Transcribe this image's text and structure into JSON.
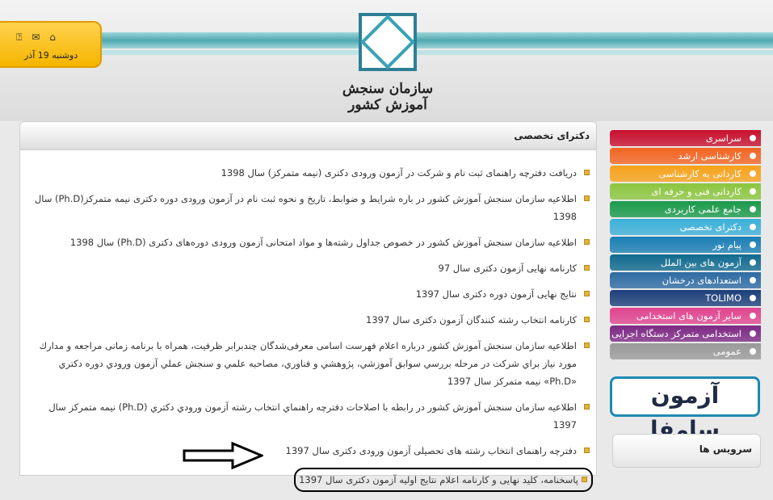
{
  "header": {
    "org_name": "سازمان سنجش آموزش کشور",
    "date": "دوشنبه 19 آذر",
    "icons": [
      "help-icon",
      "mail-icon",
      "home-icon"
    ]
  },
  "main": {
    "section_title": "دکترای تخصصی",
    "news": [
      "دریافت دفترچه راهنمای ثبت نام و شرکت در آزمون ورودی دکتری (نیمه متمرکز) سال 1398",
      "اطلاعیه سازمان سنجش آموزش کشور در باره شرایط و ضوابط، تاریخ و نحوه ثبت نام در آزمون ورودی دوره دکتری نیمه متمرکز(Ph.D) سال 1398",
      "اطلاعیه سازمان سنجش آموزش کشور در خصوص جداول رشته‌ها و مواد امتحانی آزمون ورودی دوره‌های دکتری (Ph.D) سال 1398",
      "کارنامه نهایی آزمون دکتری سال 97",
      "نتایج نهایی آزمون دوره دکتری سال 1397",
      "کارنامه انتخاب رشته کنندگان آزمون دکتری سال 1397",
      "اطلاعیه سازمان سنجش آموزش کشور درباره اعلام فهرست اسامی معرفی‌شدگان چندبرابر ظرفیت، همراه با برنامه زمانی مراجعه و مدارك مورد نياز براي شركت در مرحله بررسي سوابق آموزشي، پژوهشي و فناوري، مصاحبه علمي و سنجش عملي آزمون ورودي دوره دكتري «Ph.D» نيمه متمركز سال 1397",
      "اطلاعیه سازمان سنجش آموزش کشور در رابطه با اصلاحات دفترچه راهنماي انتخاب رشته آزمون ورودي دكتري (Ph.D) نيمه متمركز سال 1397",
      "دفترچه راهنمای انتخاب رشته های تحصیلی آزمون ورودی دکتری سال 1397",
      "پاسخنامه، کلید نهایی و کارنامه اعلام نتایج اولیه آزمون دکتری سال 1397"
    ]
  },
  "sidebar": {
    "menu": [
      {
        "label": "سراسری",
        "color": "#c8102e"
      },
      {
        "label": "کارشناسی ارشد",
        "color": "#f26522"
      },
      {
        "label": "کاردانی به کارشناسی",
        "color": "#f7a21b"
      },
      {
        "label": "کاردانی فنی و حرفه ای",
        "color": "#8cc63f"
      },
      {
        "label": "جامع علمی کاربردی",
        "color": "#1a9a4b"
      },
      {
        "label": "دکترای تخصصی",
        "color": "#3cb0d9"
      },
      {
        "label": "پیام نور",
        "color": "#1a7fb5"
      },
      {
        "label": "آزمون های بین الملل",
        "color": "#0f6a8f"
      },
      {
        "label": "استعدادهای درخشان",
        "color": "#2d6ba3"
      },
      {
        "label": "TOLIMO",
        "color": "#1d3f7a"
      },
      {
        "label": "سایر آزمون های استخدامی",
        "color": "#e0458f"
      },
      {
        "label": "استخدامی متمرکز دستگاه اجرایی",
        "color": "#7d2a84"
      },
      {
        "label": "عمومی",
        "color": "#9a9a9a"
      }
    ],
    "samfa_logo": "آزمون سامفا",
    "services_title": "سرویس ها"
  }
}
